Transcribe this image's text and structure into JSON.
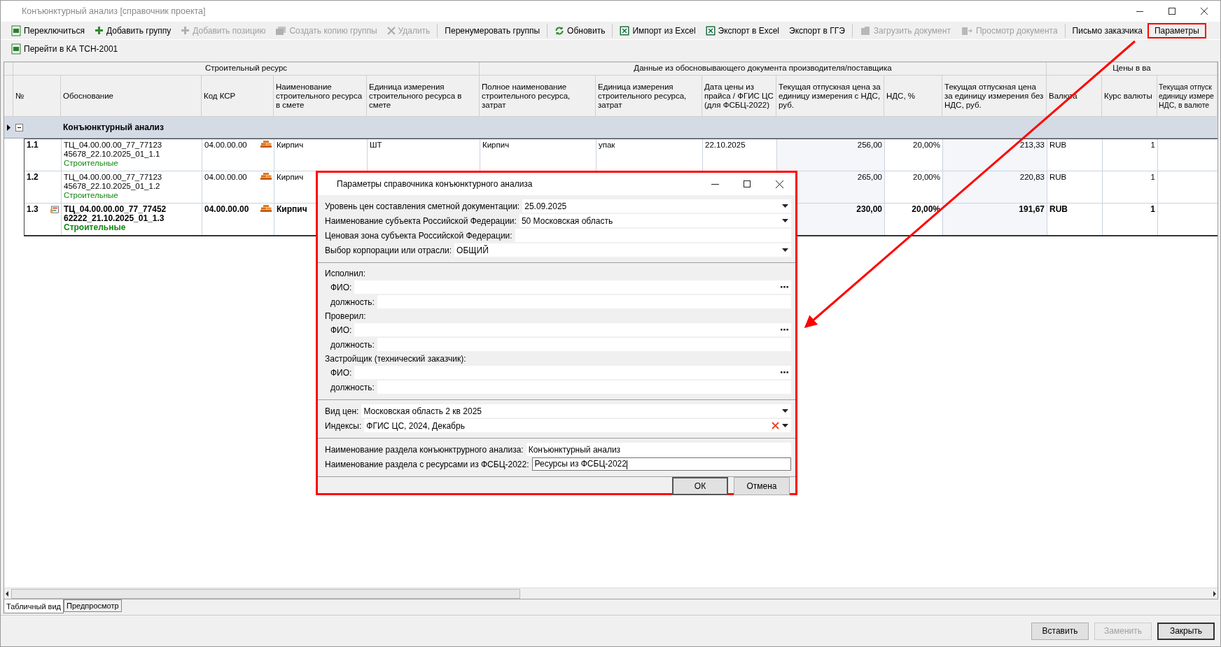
{
  "window": {
    "title": "Конъюнктурный анализ [справочник проекта]"
  },
  "toolbar": {
    "rows": [
      [
        {
          "kind": "button",
          "label": "Переключиться",
          "disabled": false,
          "highlighted": false
        },
        {
          "kind": "button",
          "label": "Добавить группу",
          "disabled": false,
          "highlighted": false
        },
        {
          "kind": "button",
          "label": "Добавить позицию",
          "disabled": true,
          "highlighted": false
        },
        {
          "kind": "button",
          "label": "Создать копию группы",
          "disabled": true,
          "highlighted": false
        },
        {
          "kind": "button",
          "label": "Удалить",
          "disabled": true,
          "highlighted": false
        },
        {
          "kind": "separator"
        },
        {
          "kind": "button",
          "label": "Перенумеровать группы",
          "disabled": false,
          "highlighted": false
        },
        {
          "kind": "separator"
        },
        {
          "kind": "button",
          "label": "Обновить",
          "disabled": false,
          "highlighted": false
        },
        {
          "kind": "separator"
        },
        {
          "kind": "button",
          "label": "Импорт из Excel",
          "disabled": false,
          "highlighted": false
        },
        {
          "kind": "button",
          "label": "Экспорт в Excel",
          "disabled": false,
          "highlighted": false
        },
        {
          "kind": "button",
          "label": "Экспорт в ГГЭ",
          "disabled": false,
          "highlighted": false
        },
        {
          "kind": "separator"
        },
        {
          "kind": "button",
          "label": "Загрузить документ",
          "disabled": true,
          "highlighted": false
        },
        {
          "kind": "button",
          "label": "Просмотр документа",
          "disabled": true,
          "highlighted": false
        },
        {
          "kind": "separator"
        },
        {
          "kind": "button",
          "label": "Письмо заказчика",
          "disabled": false,
          "highlighted": false
        },
        {
          "kind": "button",
          "label": "Параметры",
          "disabled": false,
          "highlighted": true
        }
      ],
      [
        {
          "kind": "button",
          "label": "Перейти в КА ТСН-2001",
          "disabled": false,
          "highlighted": false
        }
      ]
    ]
  },
  "table": {
    "column_groups": [
      {
        "label": "Строительный ресурс",
        "columns": [
          "№",
          "Обоснование",
          "Код КСР",
          "Наименование строительного ресурса в смете",
          "Единица измерения строительного ресурса в смете"
        ]
      },
      {
        "label": "Данные из обосновывающего документа производителя/поставщика",
        "columns": [
          "Полное наименование строительного ресурса, затрат",
          "Единица измерения строительного ресурса, затрат",
          "Дата цены из прайса / ФГИС ЦС (для ФСБЦ-2022)",
          "Текущая отпускная цена за единицу измерения с НДС, руб.",
          "НДС, %",
          "Текущая отпускная цена за единицу измерения без НДС, руб."
        ]
      },
      {
        "label": "Цены в ва",
        "columns": [
          "Валюта",
          "Курс валюты",
          "Текущая отпуск\nединицу измере\nНДС, в валюте"
        ]
      }
    ],
    "group": {
      "title": "Конъюнктурный анализ",
      "expanded": true,
      "current": true
    },
    "rows": [
      {
        "number": "1.1",
        "marked": false,
        "bold": false,
        "basis": [
          "ТЦ_04.00.00.00_77_77123",
          "45678_22.10.2025_01_1.1"
        ],
        "category": "Строительные",
        "code": "04.00.00.00",
        "resource_name": "Кирпич",
        "unit": "ШТ",
        "full_name": "Кирпич",
        "supplier_unit": "упак",
        "price_date": "22.10.2025",
        "price_with_vat": "256,00",
        "vat": "20,00%",
        "price_without_vat": "213,33",
        "currency": "RUB",
        "rate": "1"
      },
      {
        "number": "1.2",
        "marked": false,
        "bold": false,
        "basis": [
          "ТЦ_04.00.00.00_77_77123",
          "45678_22.10.2025_01_1.2"
        ],
        "category": "Строительные",
        "code": "04.00.00.00",
        "resource_name": "Кирпич",
        "price_with_vat": "265,00",
        "vat": "20,00%",
        "price_without_vat": "220,83",
        "currency": "RUB",
        "rate": "1"
      },
      {
        "number": "1.3",
        "marked": true,
        "bold": true,
        "basis": [
          "ТЦ_04.00.00.00_77_77452",
          "62222_21.10.2025_01_1.3"
        ],
        "category": "Строительные",
        "code": "04.00.00.00",
        "resource_name": "Кирпич",
        "price_with_vat": "230,00",
        "vat": "20,00%",
        "price_without_vat": "191,67",
        "currency": "RUB",
        "rate": "1"
      }
    ]
  },
  "view_tabs": [
    {
      "label": "Табличный вид",
      "selected": true
    },
    {
      "label": "Предпросмотр",
      "selected": false
    }
  ],
  "bottom_buttons": [
    {
      "label": "Вставить",
      "disabled": false,
      "default": false
    },
    {
      "label": "Заменить",
      "disabled": true,
      "default": false
    },
    {
      "label": "Закрыть",
      "disabled": false,
      "default": true
    }
  ],
  "dialog": {
    "title": "Параметры справочника конъюнктурного анализа",
    "highlighted": true,
    "sections": [
      {
        "fields": [
          {
            "kind": "dropdown",
            "label": "Уровень цен составления сметной документации:",
            "value": "25.09.2025"
          },
          {
            "kind": "dropdown",
            "label": "Наименование субъекта Российской Федерации:",
            "value": "50 Московская область"
          },
          {
            "kind": "text",
            "label": "Ценовая зона субъекта Российской Федерации:"
          },
          {
            "kind": "dropdown",
            "label": "Выбор корпорации или отрасли:",
            "value": "ОБЩИЙ"
          }
        ]
      },
      {
        "fields": [
          {
            "kind": "heading",
            "label": "Исполнил:",
            "children": [
              {
                "kind": "lookup",
                "label": "ФИО:"
              },
              {
                "kind": "text",
                "label": "должность:"
              }
            ]
          },
          {
            "kind": "heading",
            "label": "Проверил:",
            "children": [
              {
                "kind": "lookup",
                "label": "ФИО:"
              },
              {
                "kind": "text",
                "label": "должность:"
              }
            ]
          },
          {
            "kind": "heading",
            "label": "Застройщик (технический заказчик):",
            "children": [
              {
                "kind": "lookup",
                "label": "ФИО:"
              },
              {
                "kind": "text",
                "label": "должность:"
              }
            ]
          }
        ]
      },
      {
        "fields": [
          {
            "kind": "dropdown",
            "label": "Вид цен:",
            "value": "Московская область 2 кв 2025"
          },
          {
            "kind": "dropdown_clear",
            "label": "Индексы:",
            "value": "ФГИС ЦС, 2024, Декабрь"
          }
        ]
      },
      {
        "fields": [
          {
            "kind": "text",
            "label": "Наименование раздела конъюнктрурного анализа:",
            "value": "Конъюнктурный анализ",
            "focused": false
          },
          {
            "kind": "text",
            "label": "Наименование раздела с ресурсами из ФСБЦ-2022:",
            "value": "Ресурсы из ФСБЦ-2022",
            "focused": true
          }
        ]
      }
    ],
    "buttons": [
      {
        "label": "ОК",
        "default": true
      },
      {
        "label": "Отмена",
        "default": false
      }
    ]
  }
}
